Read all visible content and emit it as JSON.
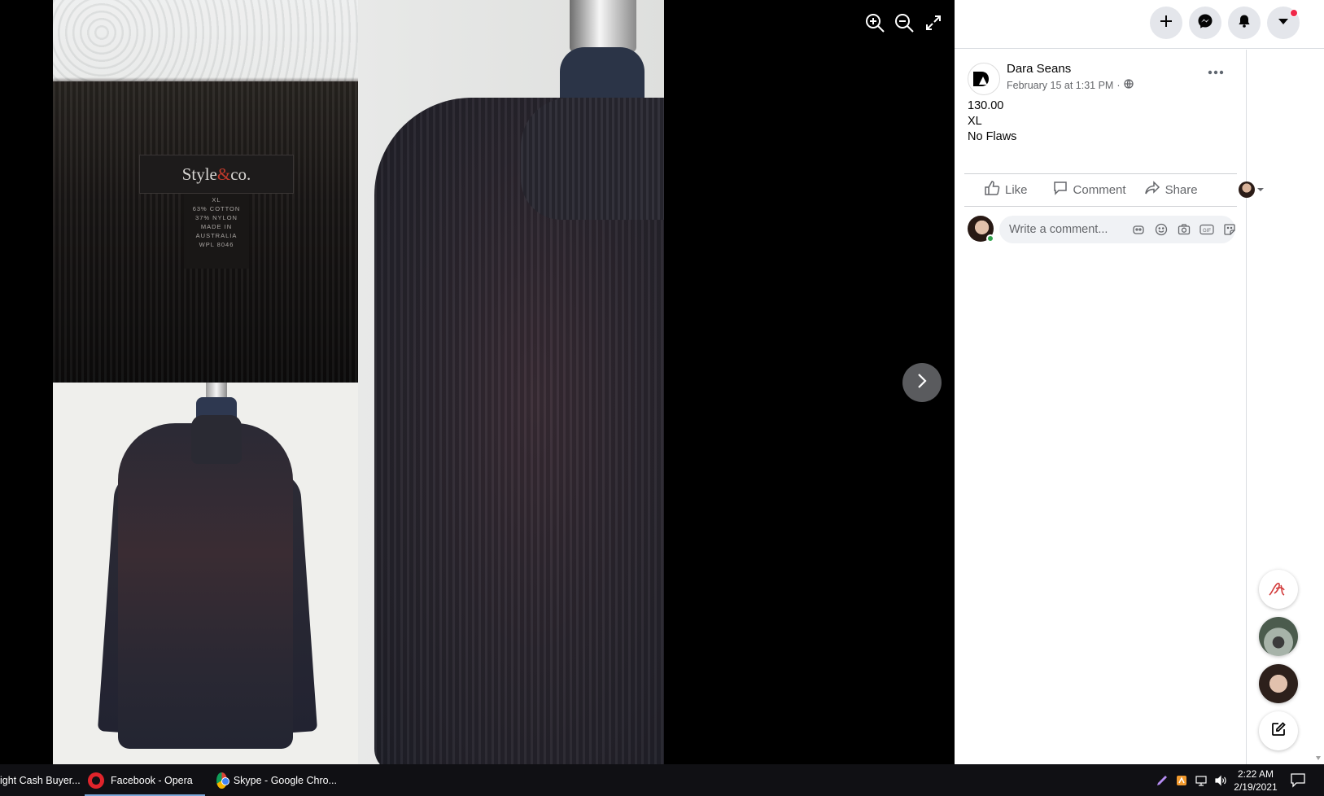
{
  "photo": {
    "brand_tag": "Style",
    "brand_amp": "&",
    "brand_suffix": "co.",
    "care_tag": [
      "XL",
      "63% COTTON",
      "37% NYLON",
      "MADE IN",
      "AUSTRALIA",
      "WPL 8046"
    ]
  },
  "post": {
    "author": "Dara Seans",
    "timestamp": "February 15 at 1:31 PM",
    "separator": "·",
    "caption": [
      "130.00",
      "XL",
      "No Flaws"
    ]
  },
  "actions": {
    "like": "Like",
    "comment": "Comment",
    "share": "Share"
  },
  "comment_input": {
    "placeholder": "Write a comment..."
  },
  "taskbar": {
    "tasks": [
      "ight Cash Buyer...",
      "Facebook - Opera",
      "Skype - Google Chro..."
    ],
    "time": "2:22 AM",
    "date": "2/19/2021"
  },
  "colors": {
    "accent_blue": "#1877f2",
    "icon_gray": "#65676b",
    "notification_red": "#f02849",
    "online_green": "#31a24c"
  },
  "icons": [
    "zoom-in-icon",
    "zoom-out-icon",
    "fullscreen-icon",
    "chevron-right-icon",
    "plus-icon",
    "messenger-icon",
    "bell-icon",
    "caret-down-icon"
  ]
}
